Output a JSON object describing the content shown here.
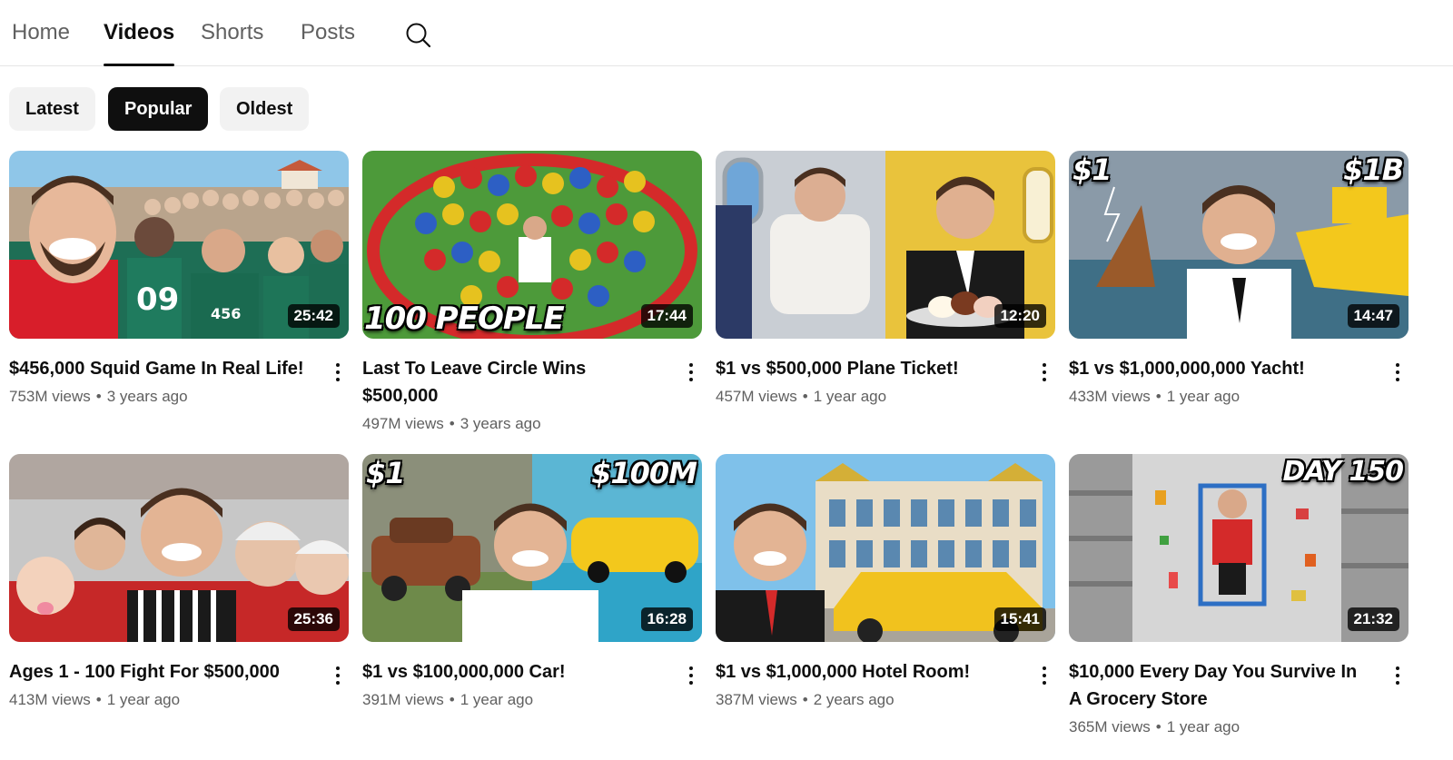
{
  "tabs": [
    {
      "label": "Home",
      "active": false
    },
    {
      "label": "Videos",
      "active": true
    },
    {
      "label": "Shorts",
      "active": false
    },
    {
      "label": "Posts",
      "active": false
    }
  ],
  "search_icon": "search-icon",
  "chips": [
    {
      "label": "Latest",
      "selected": false
    },
    {
      "label": "Popular",
      "selected": true
    },
    {
      "label": "Oldest",
      "selected": false
    }
  ],
  "videos": [
    {
      "title": "$456,000 Squid Game In Real Life!",
      "views": "753M views",
      "age": "3 years ago",
      "duration": "25:42",
      "overlay": "",
      "overlay2": ""
    },
    {
      "title": "Last To Leave Circle Wins $500,000",
      "views": "497M views",
      "age": "3 years ago",
      "duration": "17:44",
      "overlay": "100 PEOPLE",
      "overlay2": ""
    },
    {
      "title": "$1 vs $500,000 Plane Ticket!",
      "views": "457M views",
      "age": "1 year ago",
      "duration": "12:20",
      "overlay": "",
      "overlay2": ""
    },
    {
      "title": "$1 vs $1,000,000,000 Yacht!",
      "views": "433M views",
      "age": "1 year ago",
      "duration": "14:47",
      "overlay": "$1",
      "overlay2": "$1B"
    },
    {
      "title": "Ages 1 - 100 Fight For $500,000",
      "views": "413M views",
      "age": "1 year ago",
      "duration": "25:36",
      "overlay": "",
      "overlay2": ""
    },
    {
      "title": "$1 vs $100,000,000 Car!",
      "views": "391M views",
      "age": "1 year ago",
      "duration": "16:28",
      "overlay": "$1",
      "overlay2": "$100M"
    },
    {
      "title": "$1 vs $1,000,000 Hotel Room!",
      "views": "387M views",
      "age": "2 years ago",
      "duration": "15:41",
      "overlay": "",
      "overlay2": ""
    },
    {
      "title": "$10,000 Every Day You Survive In A Grocery Store",
      "views": "365M views",
      "age": "1 year ago",
      "duration": "21:32",
      "overlay": "",
      "overlay2": "DAY 150"
    }
  ],
  "colors": {
    "text_primary": "#0f0f0f",
    "text_secondary": "#606060",
    "chip_bg": "#f2f2f2",
    "chip_selected_bg": "#0f0f0f"
  }
}
